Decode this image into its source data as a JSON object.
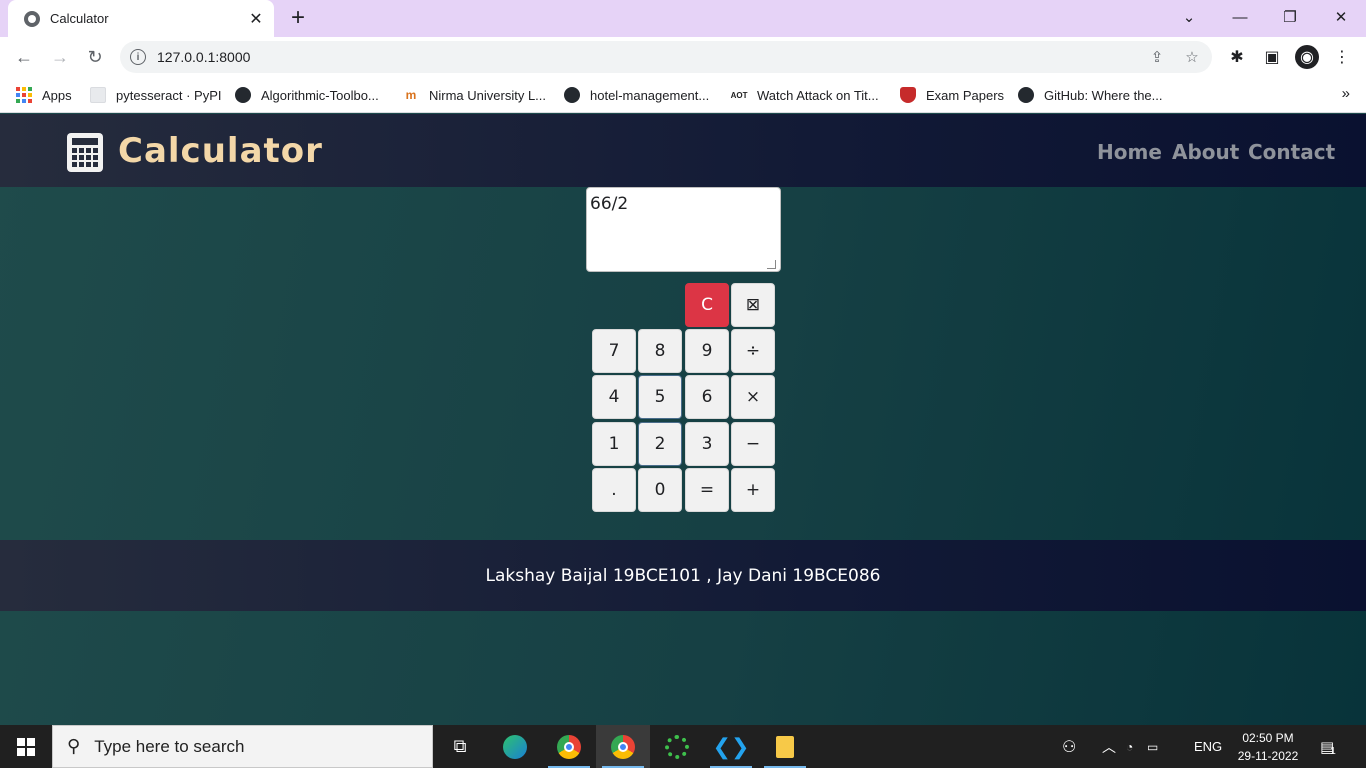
{
  "browser": {
    "tab_title": "Calculator",
    "tab_close": "✕",
    "new_tab": "+",
    "url": "127.0.0.1:8000",
    "window_controls": {
      "dropdown": "⌄",
      "minimize": "—",
      "restore": "❐",
      "close": "✕"
    }
  },
  "bookmarks": [
    {
      "label": "Apps",
      "icon": "apps-icon"
    },
    {
      "label": "pytesseract · PyPI",
      "icon": "document-icon"
    },
    {
      "label": "Algorithmic-Toolbo...",
      "icon": "github-icon"
    },
    {
      "label": "Nirma University L...",
      "icon": "nirma-icon"
    },
    {
      "label": "hotel-management...",
      "icon": "github-icon"
    },
    {
      "label": "Watch Attack on Tit...",
      "icon": "aot-icon"
    },
    {
      "label": "Exam Papers",
      "icon": "shield-icon"
    },
    {
      "label": "GitHub: Where the...",
      "icon": "github-icon"
    }
  ],
  "bookmarks_overflow": "»",
  "site": {
    "brand": "Calculator",
    "nav": [
      "Home",
      "About",
      "Contact"
    ]
  },
  "calculator": {
    "display_value": "66/2",
    "clear_label": "C",
    "backspace_label": "⊠",
    "keys": [
      [
        "7",
        "8",
        "9",
        "÷"
      ],
      [
        "4",
        "5",
        "6",
        "×"
      ],
      [
        "1",
        "2",
        "3",
        "−"
      ],
      [
        ".",
        "0",
        "=",
        "+"
      ]
    ]
  },
  "footer": {
    "credits": "Lakshay Baijal 19BCE101 , Jay Dani 19BCE086"
  },
  "taskbar": {
    "search_placeholder": "Type here to search",
    "language": "ENG",
    "time": "02:50 PM",
    "date": "29-11-2022",
    "notification_count": "1"
  },
  "colors": {
    "navbar": "#262c3d",
    "brand_text": "#f3d7a8",
    "clear_button": "#dc3545",
    "page_background": "#1d4a4c"
  }
}
